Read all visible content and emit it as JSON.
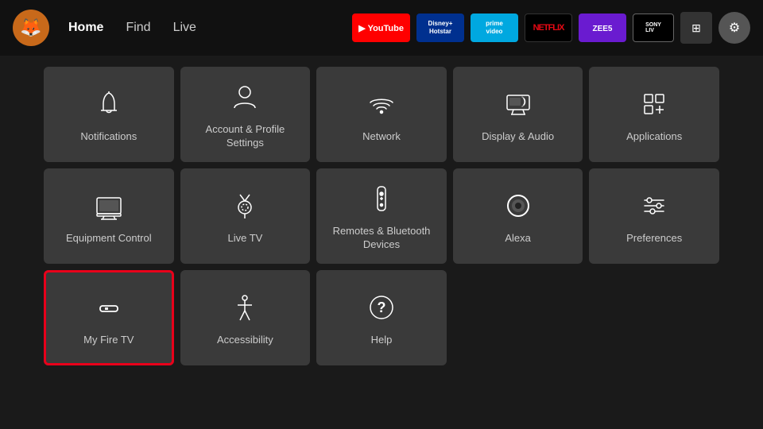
{
  "nav": {
    "logo_emoji": "🦊",
    "links": [
      {
        "label": "Home",
        "active": true
      },
      {
        "label": "Find",
        "active": false
      },
      {
        "label": "Live",
        "active": false
      }
    ],
    "apps": [
      {
        "id": "youtube",
        "label": "▶ YouTube",
        "class": "youtube"
      },
      {
        "id": "disney",
        "label": "Disney+ Hotstar",
        "class": "disney"
      },
      {
        "id": "prime",
        "label": "prime video",
        "class": "prime"
      },
      {
        "id": "netflix",
        "label": "NETFLIX",
        "class": "netflix"
      },
      {
        "id": "zee5",
        "label": "ZEE5",
        "class": "zee5"
      },
      {
        "id": "sonyliv",
        "label": "SONY LIV",
        "class": "sonyliv"
      }
    ],
    "grid_icon": "⊞",
    "settings_icon": "⚙"
  },
  "tiles": [
    {
      "id": "notifications",
      "label": "Notifications",
      "icon": "bell"
    },
    {
      "id": "account",
      "label": "Account & Profile Settings",
      "icon": "person"
    },
    {
      "id": "network",
      "label": "Network",
      "icon": "wifi"
    },
    {
      "id": "display",
      "label": "Display & Audio",
      "icon": "display"
    },
    {
      "id": "applications",
      "label": "Applications",
      "icon": "apps"
    },
    {
      "id": "equipment",
      "label": "Equipment Control",
      "icon": "tv"
    },
    {
      "id": "livetv",
      "label": "Live TV",
      "icon": "antenna"
    },
    {
      "id": "remotes",
      "label": "Remotes & Bluetooth Devices",
      "icon": "remote"
    },
    {
      "id": "alexa",
      "label": "Alexa",
      "icon": "alexa"
    },
    {
      "id": "preferences",
      "label": "Preferences",
      "icon": "sliders"
    },
    {
      "id": "myfiretv",
      "label": "My Fire TV",
      "icon": "firetv",
      "selected": true
    },
    {
      "id": "accessibility",
      "label": "Accessibility",
      "icon": "accessibility"
    },
    {
      "id": "help",
      "label": "Help",
      "icon": "help"
    }
  ]
}
